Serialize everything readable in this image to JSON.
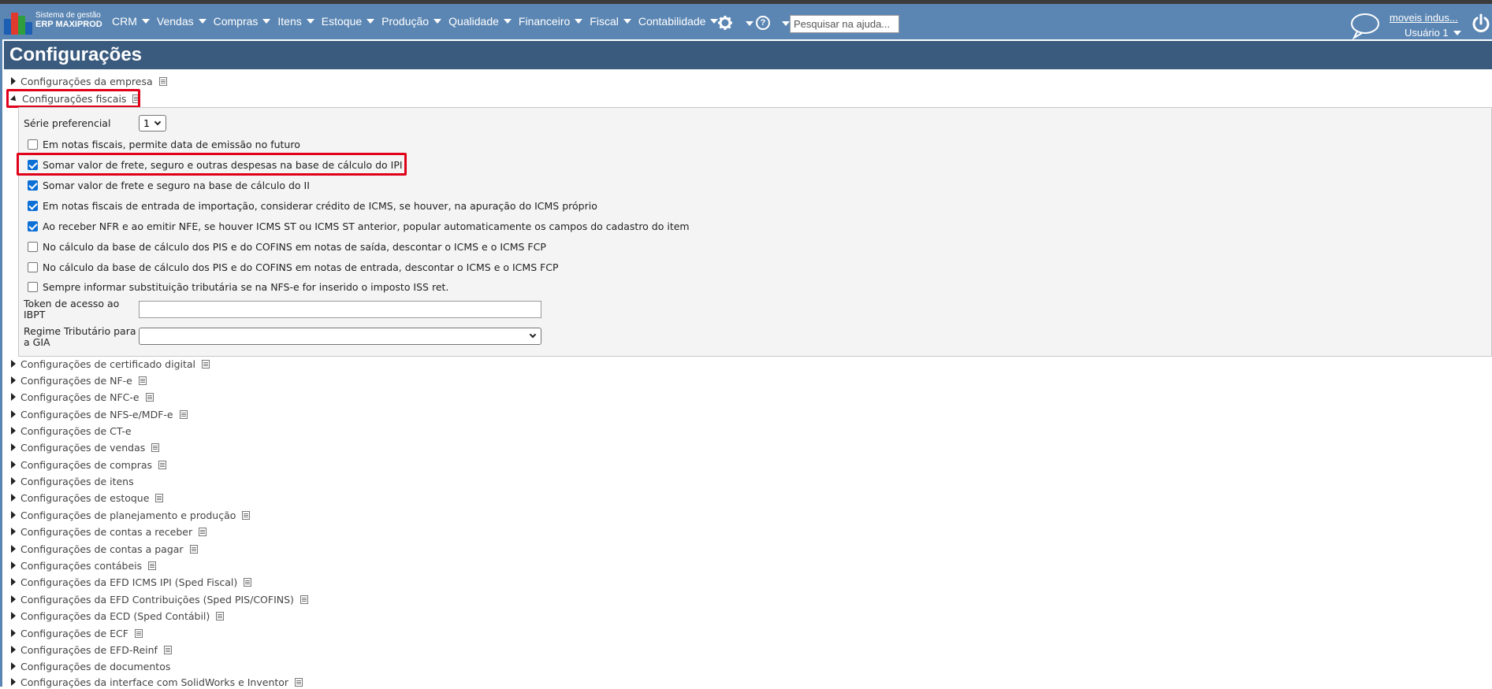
{
  "brand": {
    "line1": "Sistema de gestão",
    "line2": "ERP MAXIPROD"
  },
  "menu": [
    {
      "label": "CRM"
    },
    {
      "label": "Vendas"
    },
    {
      "label": "Compras"
    },
    {
      "label": "Itens"
    },
    {
      "label": "Estoque"
    },
    {
      "label": "Produção"
    },
    {
      "label": "Qualidade"
    },
    {
      "label": "Financeiro"
    },
    {
      "label": "Fiscal"
    },
    {
      "label": "Contabilidade"
    }
  ],
  "search": {
    "placeholder": "Pesquisar na ajuda..."
  },
  "help_icon_text": "?",
  "user": {
    "company": "moveis indus...",
    "name": "Usuário 1"
  },
  "page_title": "Configurações",
  "sections_top": [
    {
      "label": "Configurações da empresa"
    },
    {
      "label": "Configurações fiscais"
    }
  ],
  "fiscal": {
    "serie_label": "Série preferencial",
    "serie_value": "1",
    "checks": [
      {
        "label": "Em notas fiscais, permite data de emissão no futuro",
        "checked": false
      },
      {
        "label": "Somar valor de frete, seguro e outras despesas na base de cálculo do IPI",
        "checked": true
      },
      {
        "label": "Somar valor de frete e seguro na base de cálculo do II",
        "checked": true
      },
      {
        "label": "Em notas fiscais de entrada de importação, considerar crédito de ICMS, se houver, na apuração do ICMS próprio",
        "checked": true
      },
      {
        "label": "Ao receber NFR e ao emitir NFE, se houver ICMS ST ou ICMS ST anterior, popular automaticamente os campos do cadastro do item",
        "checked": true
      },
      {
        "label": "No cálculo da base de cálculo dos PIS e do COFINS em notas de saída, descontar o ICMS e o ICMS FCP",
        "checked": false
      },
      {
        "label": "No cálculo da base de cálculo dos PIS e do COFINS em notas de entrada, descontar o ICMS e o ICMS FCP",
        "checked": false
      },
      {
        "label": "Sempre informar substituição tributária se na NFS-e for inserido o imposto ISS ret.",
        "checked": false
      }
    ],
    "token_label_1": "Token de acesso ao",
    "token_label_2": "IBPT",
    "token_value": "",
    "regime_label_1": "Regime Tributário para",
    "regime_label_2": "a GIA",
    "regime_value": ""
  },
  "sections": [
    {
      "label": "Configurações de certificado digital",
      "doc": true
    },
    {
      "label": "Configurações de NF-e",
      "doc": true
    },
    {
      "label": "Configurações de NFC-e",
      "doc": true
    },
    {
      "label": "Configurações de NFS-e/MDF-e",
      "doc": true
    },
    {
      "label": "Configurações de CT-e",
      "doc": false
    },
    {
      "label": "Configurações de vendas",
      "doc": true
    },
    {
      "label": "Configurações de compras",
      "doc": true
    },
    {
      "label": "Configurações de itens",
      "doc": false
    },
    {
      "label": "Configurações de estoque",
      "doc": true
    },
    {
      "label": "Configurações de planejamento e produção",
      "doc": true
    },
    {
      "label": "Configurações de contas a receber",
      "doc": true
    },
    {
      "label": "Configurações de contas a pagar",
      "doc": true
    },
    {
      "label": "Configurações contábeis",
      "doc": true
    },
    {
      "label": "Configurações da EFD ICMS IPI (Sped Fiscal)",
      "doc": true
    },
    {
      "label": "Configurações da EFD Contribuições (Sped PIS/COFINS)",
      "doc": true
    },
    {
      "label": "Configurações da ECD (Sped Contábil)",
      "doc": true
    },
    {
      "label": "Configurações de ECF",
      "doc": true
    },
    {
      "label": "Configurações de EFD-Reinf",
      "doc": true
    },
    {
      "label": "Configurações de documentos",
      "doc": false
    },
    {
      "label": "Configurações da interface com SolidWorks e Inventor",
      "doc": true
    }
  ],
  "colors": {
    "navbar": "#5b86b3",
    "titlebar": "#3a5b7e",
    "highlight": "#e0001a",
    "checkbox": "#0b6fd6"
  }
}
